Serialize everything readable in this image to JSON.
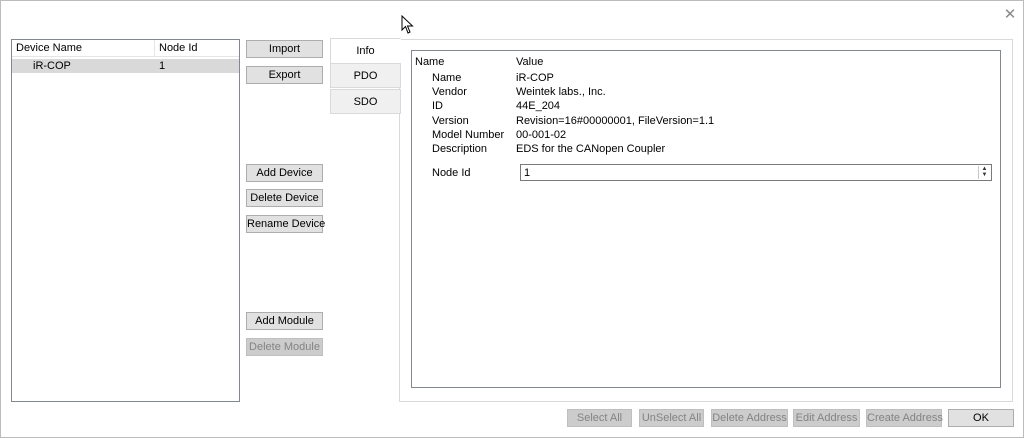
{
  "window": {
    "close_glyph": "✕"
  },
  "device_list": {
    "columns": {
      "name": "Device Name",
      "node_id": "Node Id"
    },
    "rows": [
      {
        "name": "iR-COP",
        "node_id": "1"
      }
    ]
  },
  "actions": {
    "import": "Import",
    "export": "Export",
    "add_device": "Add Device",
    "delete_device": "Delete Device",
    "rename_device": "Rename Device",
    "add_module": "Add Module",
    "delete_module": "Delete Module"
  },
  "tabs": [
    {
      "label": "Info",
      "active": true
    },
    {
      "label": "PDO",
      "active": false
    },
    {
      "label": "SDO",
      "active": false
    }
  ],
  "info": {
    "headers": {
      "name": "Name",
      "value": "Value"
    },
    "properties": [
      {
        "name": "Name",
        "value": "iR-COP"
      },
      {
        "name": "Vendor",
        "value": "Weintek labs., Inc."
      },
      {
        "name": "ID",
        "value": "44E_204"
      },
      {
        "name": "Version",
        "value": "Revision=16#00000001, FileVersion=1.1"
      },
      {
        "name": "Model Number",
        "value": "00-001-02"
      },
      {
        "name": "Description",
        "value": "EDS for the CANopen Coupler"
      }
    ],
    "node_id_label": "Node Id",
    "node_id_value": "1"
  },
  "footer": {
    "select_all": "Select All",
    "unselect_all": "UnSelect All",
    "delete_address": "Delete Address",
    "edit_address": "Edit Address",
    "create_address": "Create Address",
    "ok": "OK"
  },
  "icons": {
    "spin_up": "▲",
    "spin_down": "▼"
  }
}
